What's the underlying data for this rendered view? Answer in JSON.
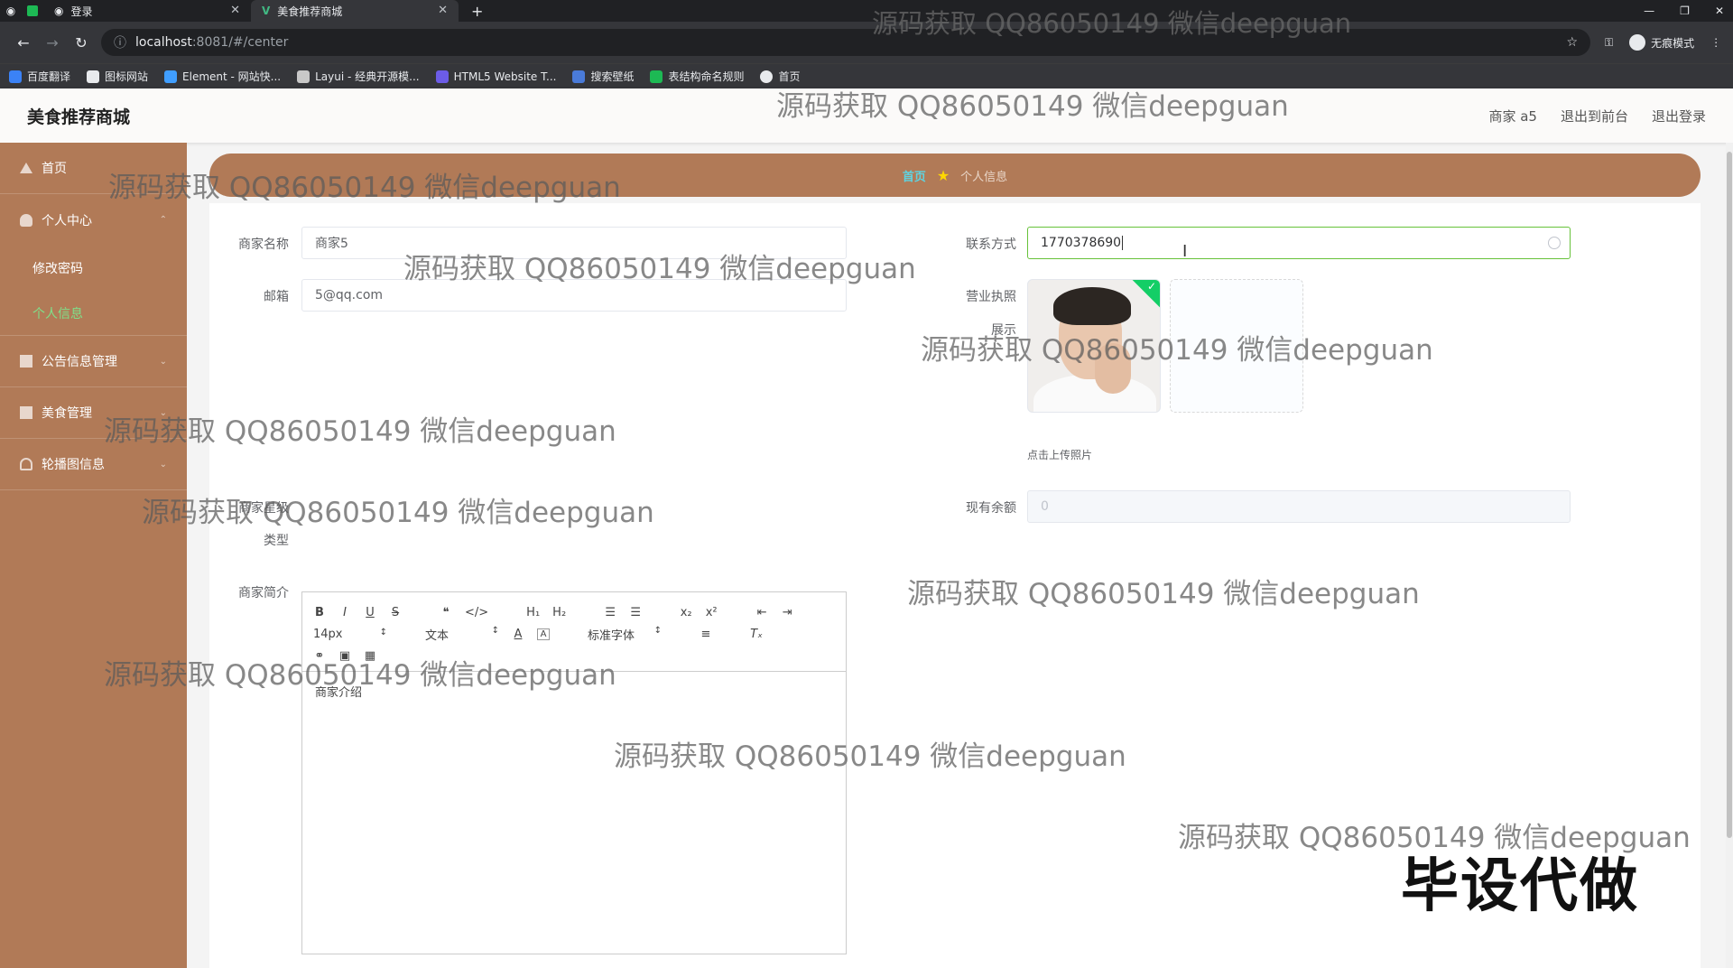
{
  "browser": {
    "tabs": [
      {
        "label": "登录"
      },
      {
        "label": "美食推荐商城"
      }
    ],
    "url_host": "localhost",
    "url_path": ":8081/#/center",
    "incognito_label": "无痕模式",
    "bookmarks": [
      {
        "label": "百度翻译",
        "color": "#3b82f6"
      },
      {
        "label": "图标网站",
        "color": "#e8eaed"
      },
      {
        "label": "Element - 网站快...",
        "color": "#409eff"
      },
      {
        "label": "Layui - 经典开源模...",
        "color": "#c8c8c8"
      },
      {
        "label": "HTML5 Website T...",
        "color": "#6c5ce7"
      },
      {
        "label": "搜索壁纸",
        "color": "#4a7bd9"
      },
      {
        "label": "表结构命名规则",
        "color": "#1db954"
      },
      {
        "label": "首页",
        "color": "#e8eaed"
      }
    ]
  },
  "header": {
    "brand": "美食推荐商城",
    "user": "商家 a5",
    "back_front": "退出到前台",
    "logout": "退出登录"
  },
  "sidebar": {
    "home": "首页",
    "personal_center": "个人中心",
    "change_password": "修改密码",
    "personal_info": "个人信息",
    "notice_mgmt": "公告信息管理",
    "food_mgmt": "美食管理",
    "carousel": "轮播图信息"
  },
  "breadcrumb": {
    "home": "首页",
    "current": "个人信息"
  },
  "form": {
    "merchant_name_label": "商家名称",
    "merchant_name_value": "商家5",
    "email_label": "邮箱",
    "email_value": "5@qq.com",
    "contact_label": "联系方式",
    "contact_value": "1770378690",
    "license_label": "营业执照",
    "license_sub": "展示",
    "upload_tip": "点击上传照片",
    "balance_label": "现有余额",
    "balance_value": "0",
    "merchant_type_label": "商家星级",
    "type_label": "类型",
    "intro_label": "商家简介",
    "intro_text": "商家介绍"
  },
  "editor": {
    "font_size": "14px",
    "text_style": "文本",
    "font_family": "标准字体"
  },
  "watermark_text": "源码获取 QQ86050149 微信deepguan",
  "corner_tag": "毕设代做"
}
